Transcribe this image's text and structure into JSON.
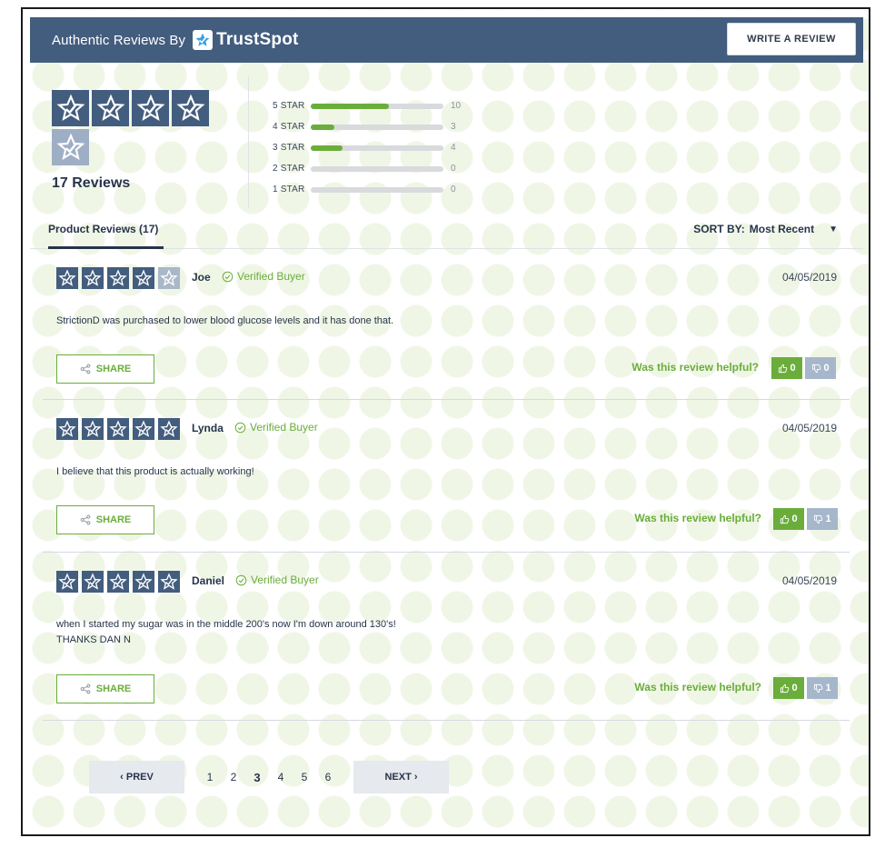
{
  "header": {
    "authentic_label": "Authentic Reviews By",
    "brand_name": "TrustSpot",
    "write_review_label": "WRITE A REVIEW",
    "bar_color": "#435d7e"
  },
  "summary": {
    "average_rating": 4,
    "total_reviews_label": "17 Reviews",
    "distribution": [
      {
        "label": "5 STAR",
        "count": "10",
        "fraction": 0.59
      },
      {
        "label": "4 STAR",
        "count": "3",
        "fraction": 0.18
      },
      {
        "label": "3 STAR",
        "count": "4",
        "fraction": 0.24
      },
      {
        "label": "2 STAR",
        "count": "0",
        "fraction": 0
      },
      {
        "label": "1 STAR",
        "count": "0",
        "fraction": 0
      }
    ]
  },
  "tabs": {
    "product_reviews_label": "Product Reviews (17)",
    "sort_label": "SORT BY:",
    "sort_value": "Most Recent"
  },
  "reviews": [
    {
      "rating": 4,
      "name": "Joe",
      "verified_label": "Verified Buyer",
      "date": "04/05/2019",
      "text_lines": [
        "StrictionD was purchased to lower blood glucose levels and it has done that."
      ],
      "share_label": "SHARE",
      "helpful_label": "Was this review helpful?",
      "up_votes": "0",
      "down_votes": "0"
    },
    {
      "rating": 5,
      "name": "Lynda",
      "verified_label": "Verified Buyer",
      "date": "04/05/2019",
      "text_lines": [
        "I believe that this product is actually working!"
      ],
      "share_label": "SHARE",
      "helpful_label": "Was this review helpful?",
      "up_votes": "0",
      "down_votes": "1"
    },
    {
      "rating": 5,
      "name": "Daniel",
      "verified_label": "Verified Buyer",
      "date": "04/05/2019",
      "text_lines": [
        "when I started my sugar was in the middle 200's now I'm down around 130's!",
        "THANKS DAN N"
      ],
      "share_label": "SHARE",
      "helpful_label": "Was this review helpful?",
      "up_votes": "0",
      "down_votes": "1"
    }
  ],
  "pagination": {
    "prev_label": "‹ PREV",
    "next_label": "NEXT ›",
    "pages": [
      "1",
      "2",
      "3",
      "4",
      "5",
      "6"
    ],
    "current_page": "3"
  },
  "colors": {
    "accent_green": "#6aad3b",
    "navy": "#435d7e",
    "vote_down": "#a6b6cb"
  }
}
